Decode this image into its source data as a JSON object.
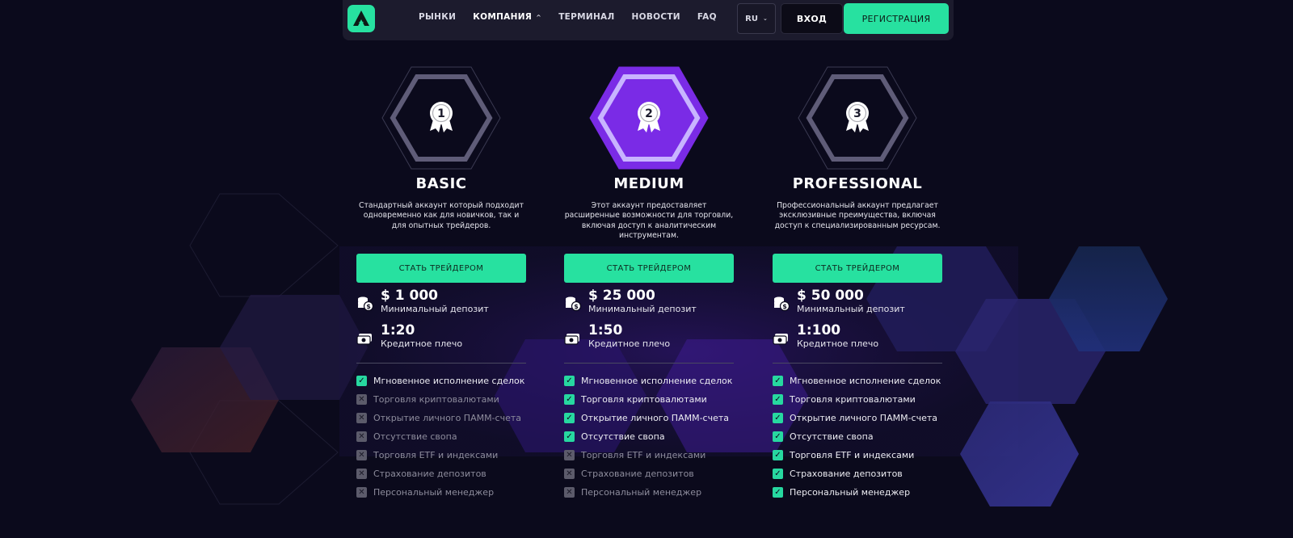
{
  "nav": {
    "items": [
      {
        "label": "РЫНКИ",
        "active": false,
        "caret": ""
      },
      {
        "label": "КОМПАНИЯ",
        "active": true,
        "caret": "^"
      },
      {
        "label": "ТЕРМИНАЛ",
        "active": false,
        "caret": ""
      },
      {
        "label": "НОВОСТИ",
        "active": false,
        "caret": ""
      },
      {
        "label": "FAQ",
        "active": false,
        "caret": ""
      }
    ],
    "lang": "RU",
    "lang_caret": "⌄",
    "login": "ВХОД",
    "register": "РЕГИСТРАЦИЯ"
  },
  "colors": {
    "accent": "#27e1a0",
    "highlight": "#7a2be6",
    "background": "#0b0a1c"
  },
  "plans": [
    {
      "number": "1",
      "name": "BASIC",
      "highlighted": false,
      "description": [
        "Стандартный аккаунт который подходит",
        "одновременно как для новичков, так и",
        "для опытных трейдеров."
      ],
      "cta": "СТАТЬ ТРЕЙДЕРОМ",
      "deposit_value": "$ 1 000",
      "deposit_label": "Минимальный депозит",
      "leverage_value": "1:20",
      "leverage_label": "Кредитное плечо",
      "features": [
        {
          "label": "Мгновенное исполнение сделок",
          "included": true
        },
        {
          "label": "Торговля криптовалютами",
          "included": false
        },
        {
          "label": "Открытие личного ПАММ-счета",
          "included": false
        },
        {
          "label": "Отсутствие свопа",
          "included": false
        },
        {
          "label": "Торговля ETF и индексами",
          "included": false
        },
        {
          "label": "Страхование депозитов",
          "included": false
        },
        {
          "label": "Персональный менеджер",
          "included": false
        }
      ]
    },
    {
      "number": "2",
      "name": "MEDIUM",
      "highlighted": true,
      "description": [
        "Этот аккаунт предоставляет",
        "расширенные возможности для торговли,",
        "включая доступ к аналитическим",
        "инструментам."
      ],
      "cta": "СТАТЬ ТРЕЙДЕРОМ",
      "deposit_value": "$ 25 000",
      "deposit_label": "Минимальный депозит",
      "leverage_value": "1:50",
      "leverage_label": "Кредитное плечо",
      "features": [
        {
          "label": "Мгновенное исполнение сделок",
          "included": true
        },
        {
          "label": "Торговля криптовалютами",
          "included": true
        },
        {
          "label": "Открытие личного ПАММ-счета",
          "included": true
        },
        {
          "label": "Отсутствие свопа",
          "included": true
        },
        {
          "label": "Торговля ETF и индексами",
          "included": false
        },
        {
          "label": "Страхование депозитов",
          "included": false
        },
        {
          "label": "Персональный менеджер",
          "included": false
        }
      ]
    },
    {
      "number": "3",
      "name": "PROFESSIONAL",
      "highlighted": false,
      "description": [
        "Профессиональный аккаунт предлагает",
        "эксклюзивные преимущества, включая",
        "доступ к специализированным ресурсам."
      ],
      "cta": "СТАТЬ ТРЕЙДЕРОМ",
      "deposit_value": "$ 50 000",
      "deposit_label": "Минимальный депозит",
      "leverage_value": "1:100",
      "leverage_label": "Кредитное плечо",
      "features": [
        {
          "label": "Мгновенное исполнение сделок",
          "included": true
        },
        {
          "label": "Торговля криптовалютами",
          "included": true
        },
        {
          "label": "Открытие личного ПАММ-счета",
          "included": true
        },
        {
          "label": "Отсутствие свопа",
          "included": true
        },
        {
          "label": "Торговля ETF и индексами",
          "included": true
        },
        {
          "label": "Страхование депозитов",
          "included": true
        },
        {
          "label": "Персональный менеджер",
          "included": true
        }
      ]
    }
  ]
}
